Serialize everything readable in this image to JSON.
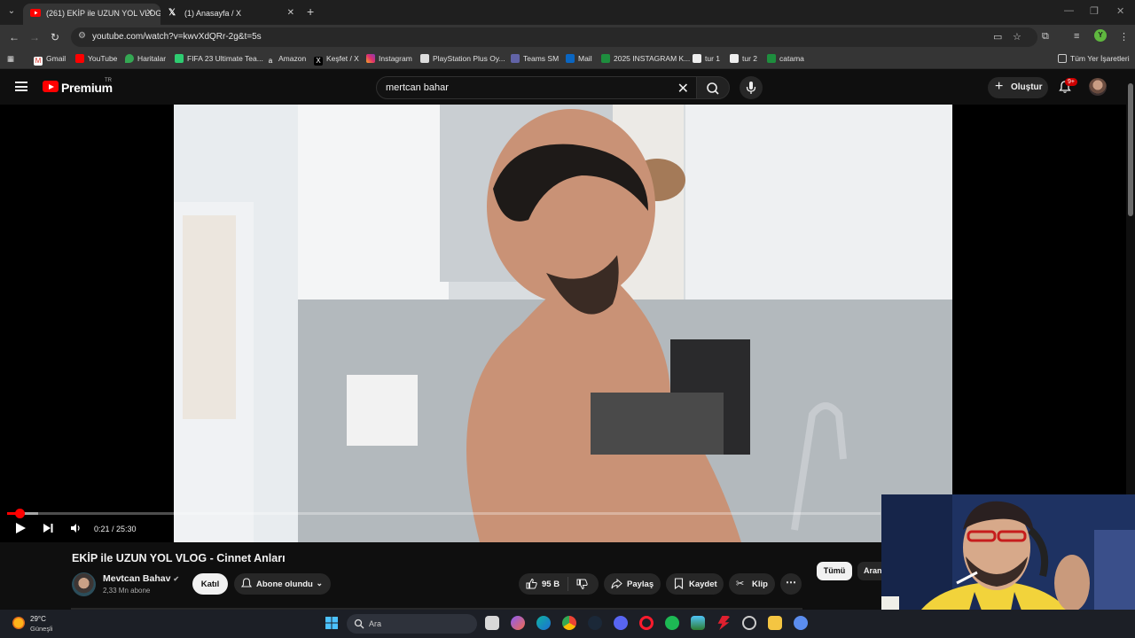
{
  "browser": {
    "tabs": [
      {
        "title": "(261) EKİP ile UZUN YOL VLOG",
        "active": true,
        "favicon": "youtube-icon"
      },
      {
        "title": "(1) Anasayfa / X",
        "active": false,
        "favicon": "x-icon"
      }
    ],
    "url": "youtube.com/watch?v=kwvXdQRr-2g&t=5s",
    "bookmarks": [
      "Gmail",
      "YouTube",
      "Haritalar",
      "FIFA 23 Ultimate Tea...",
      "Amazon",
      "Keşfet / X",
      "Instagram",
      "PlayStation Plus Oy...",
      "Teams SM",
      "Mail",
      "2025 INSTAGRAM K...",
      "tur 1",
      "tur 2",
      "catama"
    ],
    "all_bookmarks": "Tüm Yer İşaretleri",
    "profile_initial": "Y"
  },
  "youtube": {
    "logo_text": "Premium",
    "logo_region": "TR",
    "search_query": "mertcan bahar",
    "create_label": "Oluştur",
    "notif_count": "9+"
  },
  "player": {
    "time": "0:21 / 25:30",
    "progress_fraction": 0.014,
    "buffer_fraction": 0.036
  },
  "video": {
    "title": "EKİP ile UZUN YOL VLOG - Cinnet Anları",
    "channel": "Mevtcan Bahav",
    "subscribers": "2,33 Mn abone",
    "join_label": "Katıl",
    "subscribed_label": "Abone olundu",
    "likes": "95 B",
    "share_label": "Paylaş",
    "save_label": "Kaydet",
    "clip_label": "Klip"
  },
  "chips": [
    "Tümü",
    "Aranan"
  ],
  "taskbar": {
    "temperature": "29°C",
    "weather": "Güneşli",
    "search_placeholder": "Ara"
  }
}
